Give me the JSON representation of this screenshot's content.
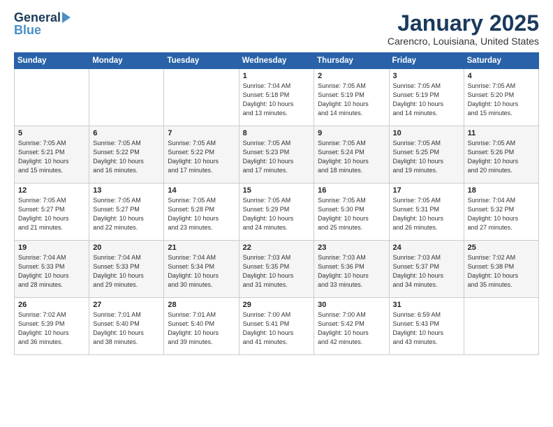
{
  "logo": {
    "line1": "General",
    "line2": "Blue"
  },
  "title": "January 2025",
  "subtitle": "Carencro, Louisiana, United States",
  "days_of_week": [
    "Sunday",
    "Monday",
    "Tuesday",
    "Wednesday",
    "Thursday",
    "Friday",
    "Saturday"
  ],
  "weeks": [
    [
      {
        "day": "",
        "info": ""
      },
      {
        "day": "",
        "info": ""
      },
      {
        "day": "",
        "info": ""
      },
      {
        "day": "1",
        "info": "Sunrise: 7:04 AM\nSunset: 5:18 PM\nDaylight: 10 hours\nand 13 minutes."
      },
      {
        "day": "2",
        "info": "Sunrise: 7:05 AM\nSunset: 5:19 PM\nDaylight: 10 hours\nand 14 minutes."
      },
      {
        "day": "3",
        "info": "Sunrise: 7:05 AM\nSunset: 5:19 PM\nDaylight: 10 hours\nand 14 minutes."
      },
      {
        "day": "4",
        "info": "Sunrise: 7:05 AM\nSunset: 5:20 PM\nDaylight: 10 hours\nand 15 minutes."
      }
    ],
    [
      {
        "day": "5",
        "info": "Sunrise: 7:05 AM\nSunset: 5:21 PM\nDaylight: 10 hours\nand 15 minutes."
      },
      {
        "day": "6",
        "info": "Sunrise: 7:05 AM\nSunset: 5:22 PM\nDaylight: 10 hours\nand 16 minutes."
      },
      {
        "day": "7",
        "info": "Sunrise: 7:05 AM\nSunset: 5:22 PM\nDaylight: 10 hours\nand 17 minutes."
      },
      {
        "day": "8",
        "info": "Sunrise: 7:05 AM\nSunset: 5:23 PM\nDaylight: 10 hours\nand 17 minutes."
      },
      {
        "day": "9",
        "info": "Sunrise: 7:05 AM\nSunset: 5:24 PM\nDaylight: 10 hours\nand 18 minutes."
      },
      {
        "day": "10",
        "info": "Sunrise: 7:05 AM\nSunset: 5:25 PM\nDaylight: 10 hours\nand 19 minutes."
      },
      {
        "day": "11",
        "info": "Sunrise: 7:05 AM\nSunset: 5:26 PM\nDaylight: 10 hours\nand 20 minutes."
      }
    ],
    [
      {
        "day": "12",
        "info": "Sunrise: 7:05 AM\nSunset: 5:27 PM\nDaylight: 10 hours\nand 21 minutes."
      },
      {
        "day": "13",
        "info": "Sunrise: 7:05 AM\nSunset: 5:27 PM\nDaylight: 10 hours\nand 22 minutes."
      },
      {
        "day": "14",
        "info": "Sunrise: 7:05 AM\nSunset: 5:28 PM\nDaylight: 10 hours\nand 23 minutes."
      },
      {
        "day": "15",
        "info": "Sunrise: 7:05 AM\nSunset: 5:29 PM\nDaylight: 10 hours\nand 24 minutes."
      },
      {
        "day": "16",
        "info": "Sunrise: 7:05 AM\nSunset: 5:30 PM\nDaylight: 10 hours\nand 25 minutes."
      },
      {
        "day": "17",
        "info": "Sunrise: 7:05 AM\nSunset: 5:31 PM\nDaylight: 10 hours\nand 26 minutes."
      },
      {
        "day": "18",
        "info": "Sunrise: 7:04 AM\nSunset: 5:32 PM\nDaylight: 10 hours\nand 27 minutes."
      }
    ],
    [
      {
        "day": "19",
        "info": "Sunrise: 7:04 AM\nSunset: 5:33 PM\nDaylight: 10 hours\nand 28 minutes."
      },
      {
        "day": "20",
        "info": "Sunrise: 7:04 AM\nSunset: 5:33 PM\nDaylight: 10 hours\nand 29 minutes."
      },
      {
        "day": "21",
        "info": "Sunrise: 7:04 AM\nSunset: 5:34 PM\nDaylight: 10 hours\nand 30 minutes."
      },
      {
        "day": "22",
        "info": "Sunrise: 7:03 AM\nSunset: 5:35 PM\nDaylight: 10 hours\nand 31 minutes."
      },
      {
        "day": "23",
        "info": "Sunrise: 7:03 AM\nSunset: 5:36 PM\nDaylight: 10 hours\nand 33 minutes."
      },
      {
        "day": "24",
        "info": "Sunrise: 7:03 AM\nSunset: 5:37 PM\nDaylight: 10 hours\nand 34 minutes."
      },
      {
        "day": "25",
        "info": "Sunrise: 7:02 AM\nSunset: 5:38 PM\nDaylight: 10 hours\nand 35 minutes."
      }
    ],
    [
      {
        "day": "26",
        "info": "Sunrise: 7:02 AM\nSunset: 5:39 PM\nDaylight: 10 hours\nand 36 minutes."
      },
      {
        "day": "27",
        "info": "Sunrise: 7:01 AM\nSunset: 5:40 PM\nDaylight: 10 hours\nand 38 minutes."
      },
      {
        "day": "28",
        "info": "Sunrise: 7:01 AM\nSunset: 5:40 PM\nDaylight: 10 hours\nand 39 minutes."
      },
      {
        "day": "29",
        "info": "Sunrise: 7:00 AM\nSunset: 5:41 PM\nDaylight: 10 hours\nand 41 minutes."
      },
      {
        "day": "30",
        "info": "Sunrise: 7:00 AM\nSunset: 5:42 PM\nDaylight: 10 hours\nand 42 minutes."
      },
      {
        "day": "31",
        "info": "Sunrise: 6:59 AM\nSunset: 5:43 PM\nDaylight: 10 hours\nand 43 minutes."
      },
      {
        "day": "",
        "info": ""
      }
    ]
  ]
}
